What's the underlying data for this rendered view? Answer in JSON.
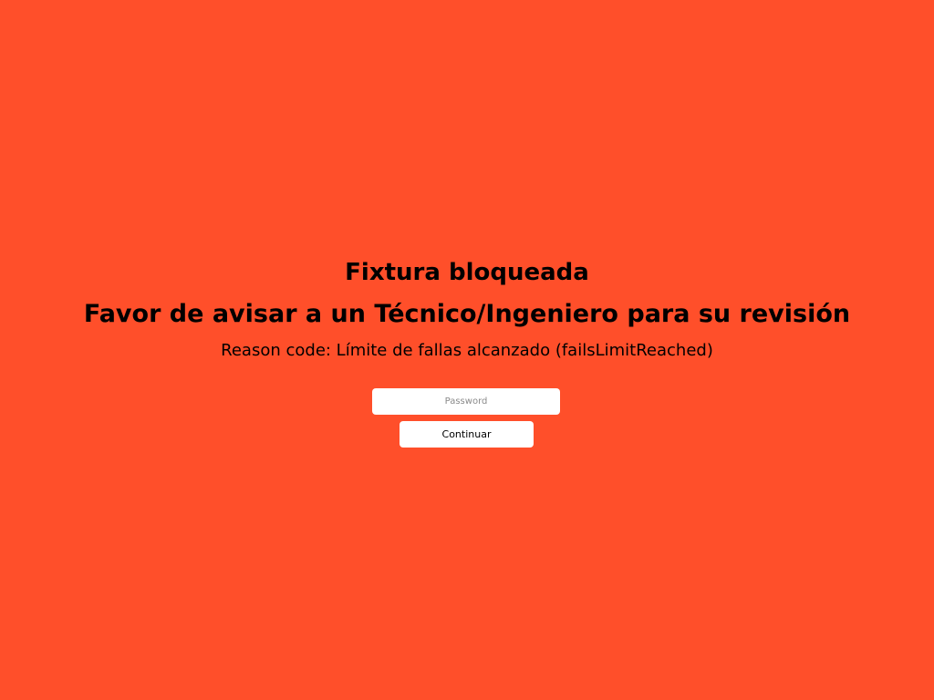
{
  "screen": {
    "background_color": "#ff4f2a",
    "title": "Fixtura bloqueada",
    "subtitle": "Favor de avisar a un Técnico/Ingeniero para su revisión",
    "reason": "Reason code: Límite de fallas alcanzado (failsLimitReached)"
  },
  "form": {
    "password_placeholder": "Password",
    "password_value": "",
    "continue_label": "Continuar"
  }
}
